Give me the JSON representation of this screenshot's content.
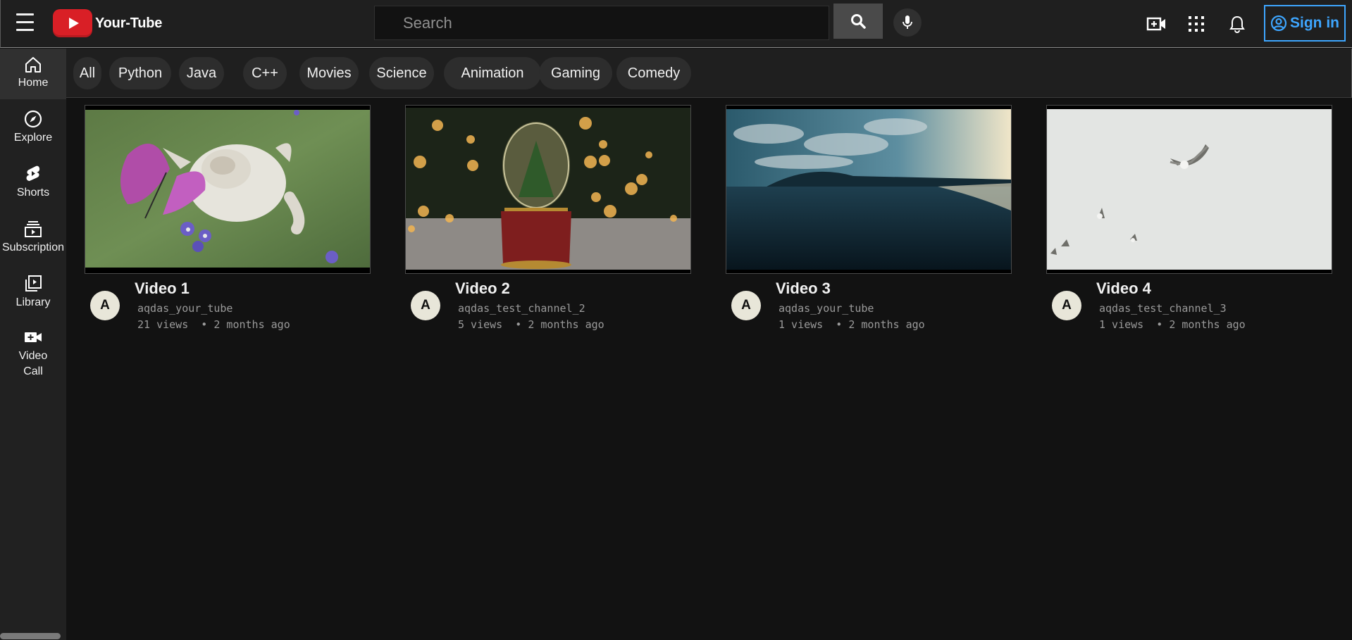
{
  "header": {
    "logo_text": "Your-Tube",
    "search_placeholder": "Search",
    "sign_in_label": "Sign in"
  },
  "sidebar": {
    "items": [
      {
        "label": "Home",
        "icon": "home-icon"
      },
      {
        "label": "Explore",
        "icon": "compass-icon"
      },
      {
        "label": "Shorts",
        "icon": "shorts-icon"
      },
      {
        "label": "Subscription",
        "icon": "subscriptions-icon"
      },
      {
        "label": "Library",
        "icon": "library-icon"
      },
      {
        "label": "Video Call",
        "icon": "video-call-icon"
      }
    ]
  },
  "chips": [
    "All",
    "Python",
    "Java",
    "C++",
    "Movies",
    "Science",
    "Animation",
    "Gaming",
    "Comedy"
  ],
  "videos": [
    {
      "title": "Video 1",
      "avatar": "A",
      "channel": "aqdas_your_tube",
      "views": "21 views",
      "age": "2 months ago"
    },
    {
      "title": "Video 2",
      "avatar": "A",
      "channel": "aqdas_test_channel_2",
      "views": "5 views",
      "age": "2 months ago"
    },
    {
      "title": "Video 3",
      "avatar": "A",
      "channel": "aqdas_your_tube",
      "views": "1 views",
      "age": "2 months ago"
    },
    {
      "title": "Video 4",
      "avatar": "A",
      "channel": "aqdas_test_channel_3",
      "views": "1 views",
      "age": "2 months ago"
    }
  ],
  "colors": {
    "accent": "#3ea6ff",
    "brand": "#d91f26",
    "background": "#121212"
  }
}
